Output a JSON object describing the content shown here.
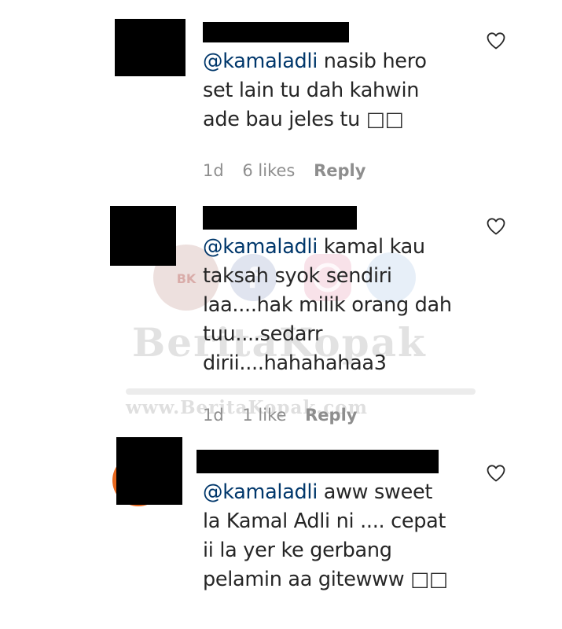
{
  "comments": [
    {
      "mention": "@kamaladli",
      "first_line_rest": " nasib hero",
      "lines": [
        "set lain tu dah kahwin",
        "ade bau jeles tu □□"
      ],
      "time": "1d",
      "likes": "6 likes",
      "reply": "Reply"
    },
    {
      "mention": "@kamaladli",
      "first_line_rest": " kamal kau",
      "lines": [
        "taksah syok sendiri",
        "laa....hak milik orang dah",
        "tuu....sedarr",
        "dirii....hahahahaa3"
      ],
      "time": "1d",
      "likes": "1 like",
      "reply": "Reply"
    },
    {
      "mention": "@kamaladli",
      "first_line_rest": " aww sweet",
      "lines": [
        "la Kamal Adli ni .... cepat",
        "ii la yer ke gerbang",
        "pelamin aa gitewww □□"
      ],
      "time": "",
      "likes": "",
      "reply": ""
    }
  ],
  "icons": {
    "like": "heart-outline-icon"
  },
  "colors": {
    "mention": "#00376b",
    "text": "#262626",
    "meta": "#8e8e8e"
  },
  "watermark": {
    "title": "BeritaKopak",
    "url": "www.BeritaKopak.com"
  }
}
